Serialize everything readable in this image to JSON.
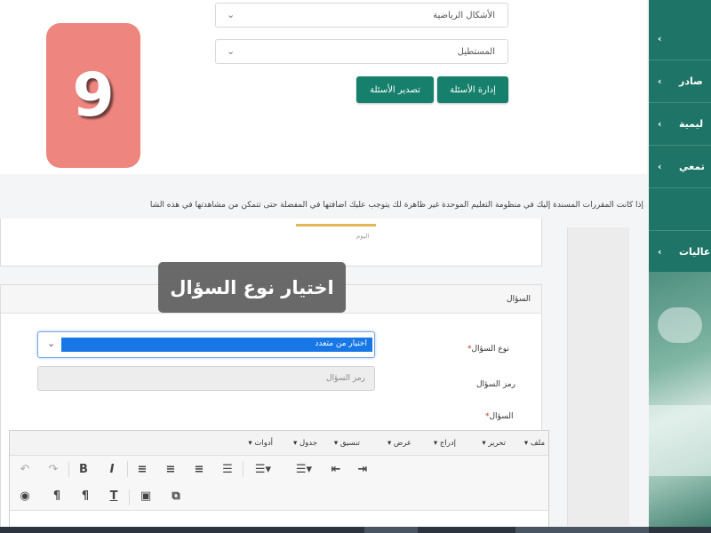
{
  "filters": {
    "shape_select": "الأشكال الرياضية",
    "level_select": "المستطيل"
  },
  "buttons": {
    "manage_questions": "إدارة الأسئلة",
    "export_questions": "تصدير الأسئلة"
  },
  "badge_number": "9",
  "sidebar": {
    "items": [
      {
        "label": ""
      },
      {
        "label": "صادر"
      },
      {
        "label": "ليمية"
      },
      {
        "label": "تمعي"
      },
      {
        "label": ""
      },
      {
        "label": "عاليات"
      }
    ]
  },
  "notice_text": "إذا كانت المقررات المسندة إليك في منظومة التعليم الموحدة غير ظاهرة لك يتوجب عليك اضافتها في المفضلة حتى تتمكن من مشاهدتها في هذه الشا",
  "upper_card_hint": "اليوم",
  "question_panel": {
    "header": "السؤال",
    "type_label": "نوع السؤال",
    "type_value": "اختيار من متعدد",
    "code_label": "رمز السؤال",
    "code_placeholder": "رمز السؤال",
    "question_label": "السؤال"
  },
  "editor": {
    "menu": [
      "ملف",
      "تحرير",
      "إدراج",
      "عرض",
      "تنسيق",
      "جدول",
      "أدوات"
    ]
  },
  "caption": "اختيار نوع السؤال",
  "colors": {
    "teal": "#17806d",
    "sidebar": "#1e7466",
    "badge": "#ee857e",
    "selection": "#1877e6"
  }
}
